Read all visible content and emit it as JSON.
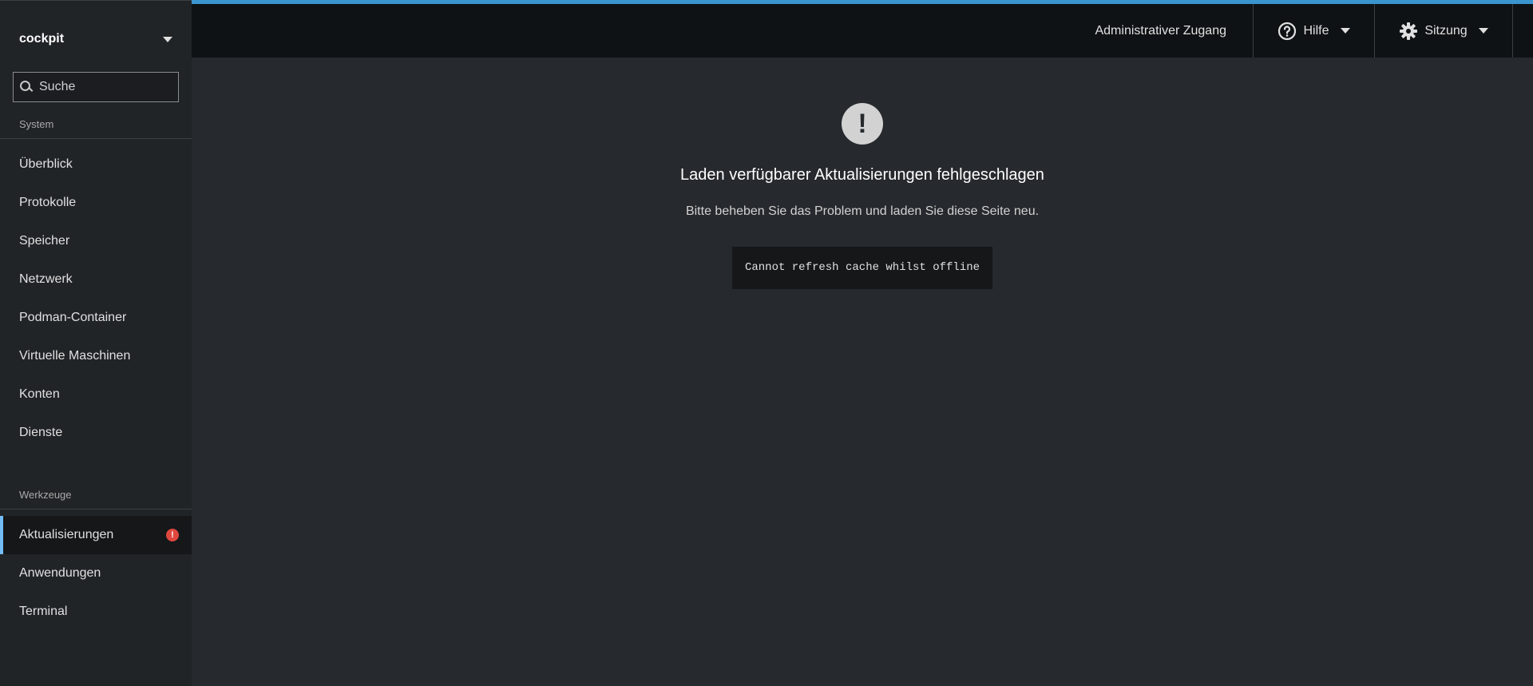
{
  "host": {
    "name": "cockpit"
  },
  "search": {
    "placeholder": "Suche"
  },
  "sections": {
    "system": "System",
    "tools": "Werkzeuge"
  },
  "nav_system": [
    "Überblick",
    "Protokolle",
    "Speicher",
    "Netzwerk",
    "Podman-Container",
    "Virtuelle Maschinen",
    "Konten",
    "Dienste"
  ],
  "nav_tools": [
    {
      "label": "Aktualisierungen",
      "active": true,
      "badge": "!"
    },
    {
      "label": "Anwendungen"
    },
    {
      "label": "Terminal"
    }
  ],
  "topbar": {
    "admin": "Administrativer Zugang",
    "help": "Hilfe",
    "session": "Sitzung"
  },
  "main": {
    "icon": "exclamation-circle-icon",
    "title": "Laden verfügbarer Aktualisierungen fehlgeschlagen",
    "body": "Bitte beheben Sie das Problem und laden Sie diese Seite neu.",
    "error_message": "Cannot refresh cache whilst offline"
  },
  "colors": {
    "accent": "#73bcf7",
    "alert": "#e0483f",
    "topline": "#3b95cf"
  }
}
